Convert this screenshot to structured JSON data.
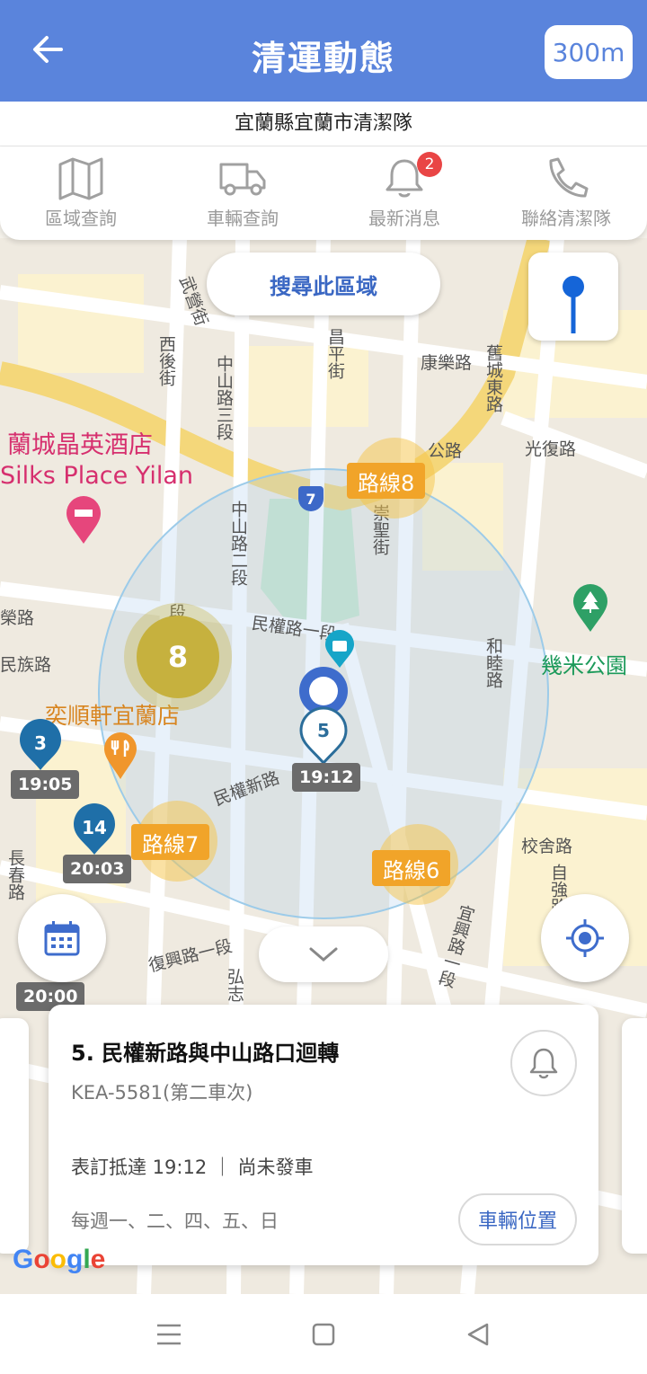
{
  "header": {
    "title": "清運動態",
    "radius_label": "300m",
    "subtitle": "宜蘭縣宜蘭市清潔隊"
  },
  "nav": {
    "items": [
      {
        "label": "區域查詢",
        "icon": "map-icon"
      },
      {
        "label": "車輛查詢",
        "icon": "truck-icon"
      },
      {
        "label": "最新消息",
        "icon": "bell-icon",
        "badge": "2"
      },
      {
        "label": "聯絡清潔隊",
        "icon": "phone-icon"
      }
    ]
  },
  "map": {
    "search_area_label": "搜尋此區域",
    "poi": {
      "hotel_zh": "蘭城晶英酒店",
      "hotel_en": "Silks Place Yilan",
      "restaurant": "奕順軒宜蘭店",
      "park": "幾米公園"
    },
    "streets": {
      "wuchang": "武營街",
      "xihou": "西後街",
      "zhongshan3": "中山路三段",
      "changping": "昌平街",
      "kangle": "康樂路",
      "jiucheng_east": "舊城東路",
      "guangfu": "光復路",
      "road_partial": "公路",
      "zhongshan2": "中山路二段",
      "chongsheng": "崇聖街",
      "minquan1": "民權路一段",
      "hemu": "和睦路",
      "rong": "榮路",
      "minzu": "民族路",
      "duan": "段",
      "minquan_new": "民權新路",
      "xiaoshe": "校舍路",
      "ziqiang": "自強路",
      "changchun": "長春路",
      "fuxing1": "復興路一段",
      "yixing1": "宜興路一段",
      "hong": "弘志",
      "highway7": "7"
    },
    "routes": [
      "路線8",
      "路線7",
      "路線6"
    ],
    "cluster_count": "8",
    "stops": [
      {
        "num": "5",
        "time": "19:12"
      },
      {
        "num": "3",
        "time": "19:05"
      },
      {
        "num": "14",
        "time": "20:03"
      },
      {
        "num": "",
        "time": "20:00"
      }
    ],
    "google": "Google"
  },
  "card": {
    "title": "5. 民權新路與中山路口迴轉",
    "plate": "KEA-5581(第二車次)",
    "arrive": "表訂抵達 19:12 ｜ 尚未發車",
    "days": "每週一、二、四、五、日",
    "vehicle_btn": "車輛位置"
  },
  "colors": {
    "primary": "#5a84dc",
    "route": "#f1a429",
    "cluster": "#c6b13e",
    "badge": "#e94545",
    "pin": "#1f6fa8"
  }
}
